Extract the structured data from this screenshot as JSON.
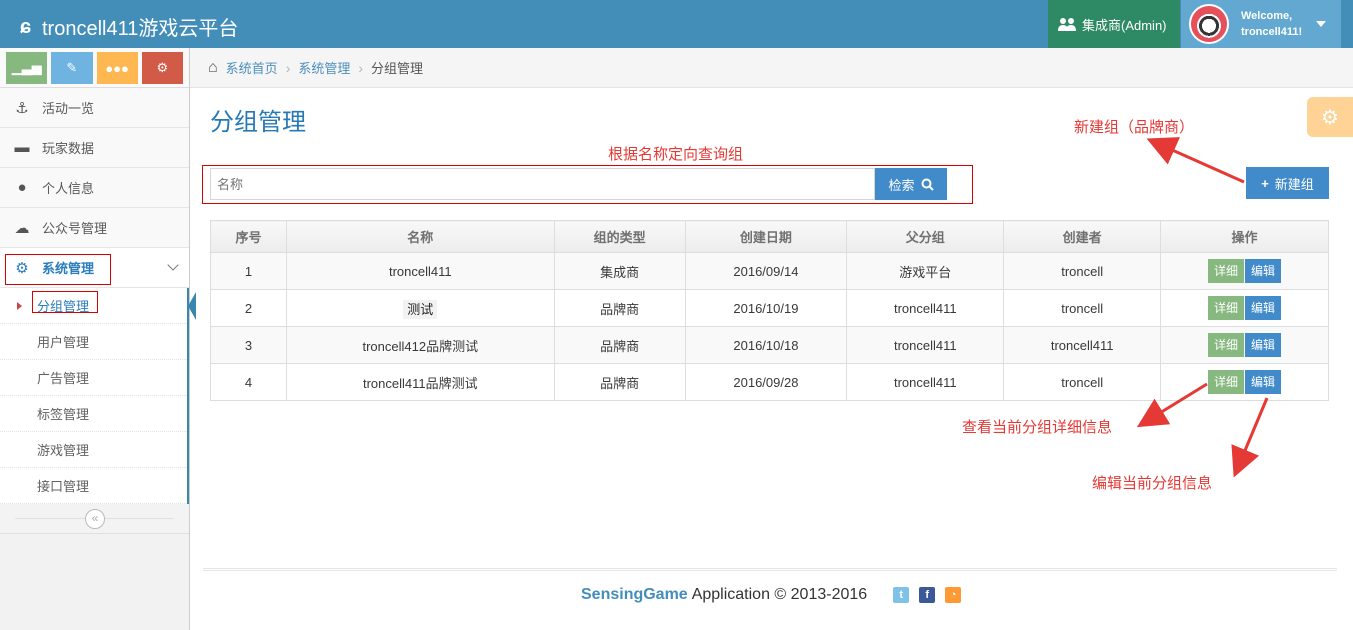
{
  "app": {
    "title": "troncell411游戏云平台"
  },
  "header": {
    "role_label": "集成商(Admin)",
    "welcome": "Welcome,",
    "username": "troncell411!"
  },
  "sidebar": {
    "items": [
      {
        "label": "活动一览",
        "icon": "anchor-icon"
      },
      {
        "label": "玩家数据",
        "icon": "archive-icon"
      },
      {
        "label": "个人信息",
        "icon": "user-icon"
      },
      {
        "label": "公众号管理",
        "icon": "wechat-icon"
      },
      {
        "label": "系统管理",
        "icon": "gear-icon"
      }
    ],
    "sub_items": [
      "分组管理",
      "用户管理",
      "广告管理",
      "标签管理",
      "游戏管理",
      "接口管理"
    ]
  },
  "breadcrumb": {
    "home": "系统首页",
    "section": "系统管理",
    "current": "分组管理"
  },
  "page": {
    "title": "分组管理"
  },
  "search": {
    "placeholder": "名称",
    "button": "检索"
  },
  "new_button": "新建组",
  "annotations": {
    "new_group": "新建组（品牌商）",
    "search": "根据名称定向查询组",
    "detail": "查看当前分组详细信息",
    "edit": "编辑当前分组信息"
  },
  "table": {
    "headers": [
      "序号",
      "名称",
      "组的类型",
      "创建日期",
      "父分组",
      "创建者",
      "操作"
    ],
    "rows": [
      [
        "1",
        "troncell411",
        "集成商",
        "2016/09/14",
        "游戏平台",
        "troncell"
      ],
      [
        "2",
        "测试",
        "品牌商",
        "2016/10/19",
        "troncell411",
        "troncell"
      ],
      [
        "3",
        "troncell412品牌测试",
        "品牌商",
        "2016/10/18",
        "troncell411",
        "troncell411"
      ],
      [
        "4",
        "troncell411品牌测试",
        "品牌商",
        "2016/09/28",
        "troncell411",
        "troncell"
      ]
    ],
    "detail_label": "详细",
    "edit_label": "编辑"
  },
  "footer": {
    "brand": "SensingGame",
    "text": "Application © 2013-2016"
  },
  "colors": {
    "navbar": "#438eb9",
    "role": "#2e8965",
    "primary": "#428bca",
    "success": "#87b87f",
    "annotation": "#e53935"
  }
}
